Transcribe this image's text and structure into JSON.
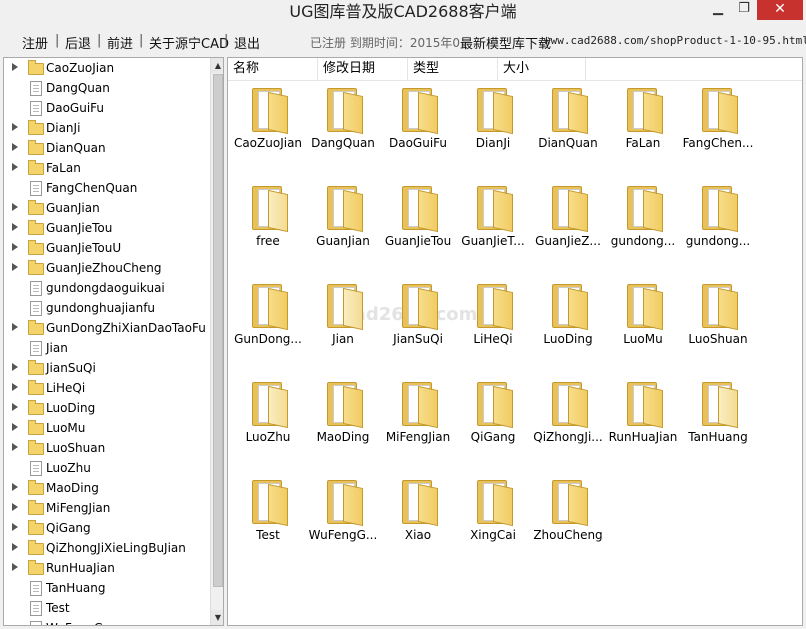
{
  "window": {
    "title": "UG图库普及版CAD2688客户端",
    "minimize": "▁",
    "maximize": "❐",
    "close": "✕"
  },
  "menu": {
    "register": "注册",
    "back": "后退",
    "forward": "前进",
    "about": "关于源宁CAD",
    "exit": "退出",
    "separator": "|",
    "status": "已注册 到期时间：2015年0",
    "download": "最新模型库下载",
    "url": "www.cad2688.com/shopProduct-1-10-95.html"
  },
  "tree": {
    "items": [
      {
        "label": "CaoZuoJian",
        "expandable": true,
        "icon": "folder-icon"
      },
      {
        "label": "DangQuan",
        "expandable": false,
        "icon": "file-icon"
      },
      {
        "label": "DaoGuiFu",
        "expandable": false,
        "icon": "file-icon"
      },
      {
        "label": "DianJi",
        "expandable": true,
        "icon": "folder-icon"
      },
      {
        "label": "DianQuan",
        "expandable": true,
        "icon": "folder-icon"
      },
      {
        "label": "FaLan",
        "expandable": true,
        "icon": "folder-icon"
      },
      {
        "label": "FangChenQuan",
        "expandable": false,
        "icon": "file-icon"
      },
      {
        "label": "GuanJian",
        "expandable": true,
        "icon": "folder-icon"
      },
      {
        "label": "GuanJieTou",
        "expandable": true,
        "icon": "folder-icon"
      },
      {
        "label": "GuanJieTouU",
        "expandable": true,
        "icon": "folder-icon"
      },
      {
        "label": "GuanJieZhouCheng",
        "expandable": true,
        "icon": "folder-icon"
      },
      {
        "label": "gundongdaoguikuai",
        "expandable": false,
        "icon": "file-icon"
      },
      {
        "label": "gundonghuajianfu",
        "expandable": false,
        "icon": "file-icon"
      },
      {
        "label": "GunDongZhiXianDaoTaoFu",
        "expandable": true,
        "icon": "folder-icon"
      },
      {
        "label": "Jian",
        "expandable": false,
        "icon": "file-icon"
      },
      {
        "label": "JianSuQi",
        "expandable": true,
        "icon": "folder-icon"
      },
      {
        "label": "LiHeQi",
        "expandable": true,
        "icon": "folder-icon"
      },
      {
        "label": "LuoDing",
        "expandable": true,
        "icon": "folder-icon"
      },
      {
        "label": "LuoMu",
        "expandable": true,
        "icon": "folder-icon"
      },
      {
        "label": "LuoShuan",
        "expandable": true,
        "icon": "folder-icon"
      },
      {
        "label": "LuoZhu",
        "expandable": false,
        "icon": "file-icon"
      },
      {
        "label": "MaoDing",
        "expandable": true,
        "icon": "folder-icon"
      },
      {
        "label": "MiFengJian",
        "expandable": true,
        "icon": "folder-icon"
      },
      {
        "label": "QiGang",
        "expandable": true,
        "icon": "folder-icon"
      },
      {
        "label": "QiZhongJiXieLingBuJian",
        "expandable": true,
        "icon": "folder-icon"
      },
      {
        "label": "RunHuaJian",
        "expandable": true,
        "icon": "folder-icon"
      },
      {
        "label": "TanHuang",
        "expandable": false,
        "icon": "file-icon"
      },
      {
        "label": "Test",
        "expandable": false,
        "icon": "file-icon"
      },
      {
        "label": "WuFengGu",
        "expandable": false,
        "icon": "file-icon"
      }
    ],
    "scroll_up": "▲",
    "scroll_down": "▼"
  },
  "content": {
    "headers": [
      "名称",
      "修改日期",
      "类型",
      "大小"
    ],
    "watermark": "cad2688.com",
    "tiles": [
      "CaoZuoJian",
      "DangQuan",
      "DaoGuiFu",
      "DianJi",
      "DianQuan",
      "FaLan",
      "FangChen...",
      "free",
      "GuanJian",
      "GuanJieTou",
      "GuanJieT...",
      "GuanJieZ...",
      "gundong...",
      "gundong...",
      "GunDong...",
      "Jian",
      "JianSuQi",
      "LiHeQi",
      "LuoDing",
      "LuoMu",
      "LuoShuan",
      "LuoZhu",
      "MaoDing",
      "MiFengJian",
      "QiGang",
      "QiZhongJi...",
      "RunHuaJian",
      "TanHuang",
      "Test",
      "WuFengG...",
      "Xiao",
      "XingCai",
      "ZhouCheng"
    ]
  }
}
